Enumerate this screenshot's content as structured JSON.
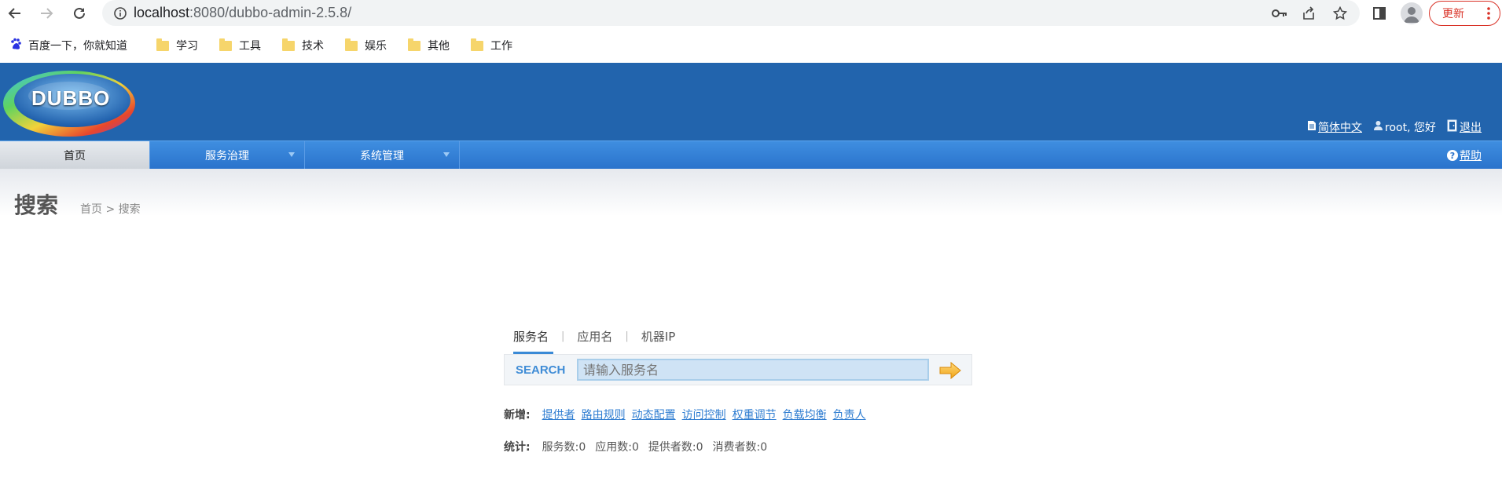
{
  "browser": {
    "url_host": "localhost",
    "url_rest": ":8080/dubbo-admin-2.5.8/",
    "update_label": "更新",
    "bookmarks": [
      {
        "label": "百度一下，你就知道",
        "icon": "baidu-paw-icon"
      },
      {
        "label": "学习",
        "icon": "folder-icon"
      },
      {
        "label": "工具",
        "icon": "folder-icon"
      },
      {
        "label": "技术",
        "icon": "folder-icon"
      },
      {
        "label": "娱乐",
        "icon": "folder-icon"
      },
      {
        "label": "其他",
        "icon": "folder-icon"
      },
      {
        "label": "工作",
        "icon": "folder-icon"
      }
    ]
  },
  "header": {
    "logo_text": "DUBBO",
    "language_link": "简体中文",
    "user_greeting": "root, 您好",
    "logout_link": "退出"
  },
  "menu": {
    "items": [
      {
        "label": "首页",
        "active": true
      },
      {
        "label": "服务治理",
        "dropdown": true
      },
      {
        "label": "系统管理",
        "dropdown": true
      }
    ],
    "help_link": "帮助"
  },
  "page": {
    "title": "搜索",
    "breadcrumb": "首页 > 搜索"
  },
  "search": {
    "tabs": [
      "服务名",
      "应用名",
      "机器IP"
    ],
    "active_tab": "服务名",
    "label": "SEARCH",
    "placeholder": "请输入服务名"
  },
  "quick_add": {
    "label": "新增:",
    "links": [
      "提供者",
      "路由规则",
      "动态配置",
      "访问控制",
      "权重调节",
      "负载均衡",
      "负责人"
    ]
  },
  "stats": {
    "label": "统计:",
    "items": [
      "服务数:0",
      "应用数:0",
      "提供者数:0",
      "消费者数:0"
    ]
  },
  "colors": {
    "header_bg": "#2264ad",
    "menu_bg": "#2a73cc",
    "link": "#2f7dd1",
    "update_red": "#d93025"
  }
}
